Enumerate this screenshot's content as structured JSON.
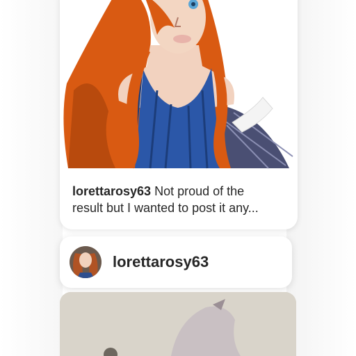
{
  "post": {
    "username": "lorettarosy63",
    "caption_line1": "Not proud of the",
    "caption_line2": "result but I wanted to post it any..."
  },
  "author": {
    "username": "lorettarosy63"
  },
  "icons": {
    "avatar": "avatar-image"
  }
}
